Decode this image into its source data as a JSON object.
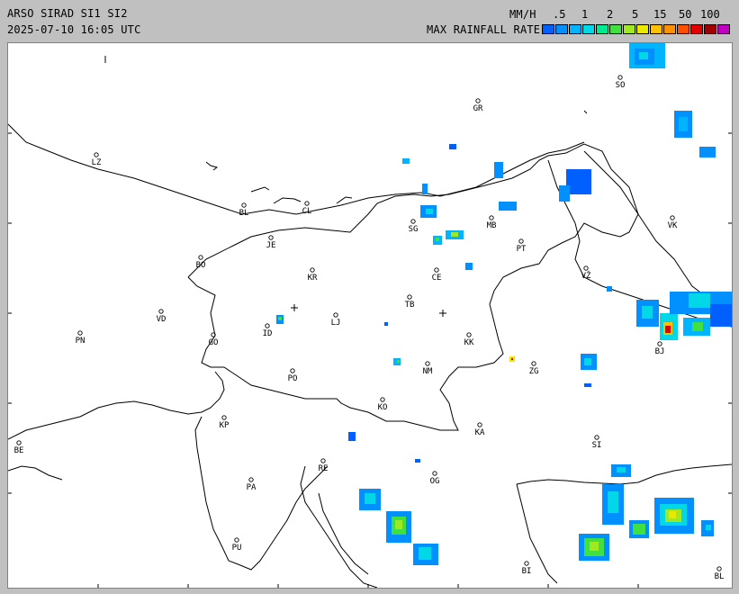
{
  "header": {
    "title": "ARSO SIRAD SI1 SI2",
    "timestamp": "2025-07-10 16:05 UTC",
    "unit": "MM/H",
    "legend_title": "MAX RAINFALL RATE"
  },
  "scale": {
    "labels": [
      ".5",
      "1",
      "2",
      "5",
      "15",
      "50",
      "100"
    ],
    "colors": [
      "#0060ff",
      "#0090ff",
      "#00b4ff",
      "#00d8e8",
      "#00e890",
      "#40e040",
      "#a0e820",
      "#e8e800",
      "#ffc000",
      "#ff9000",
      "#ff5000",
      "#e00000",
      "#a00000",
      "#c000c0"
    ]
  },
  "cities": [
    {
      "code": "GR"
    },
    {
      "code": "SO"
    },
    {
      "code": "LZ"
    },
    {
      "code": "BL"
    },
    {
      "code": "CL"
    },
    {
      "code": "MB"
    },
    {
      "code": "SG"
    },
    {
      "code": "VK"
    },
    {
      "code": "JE"
    },
    {
      "code": "PT"
    },
    {
      "code": "BO"
    },
    {
      "code": "KR"
    },
    {
      "code": "CE"
    },
    {
      "code": "VŽ"
    },
    {
      "code": "TB"
    },
    {
      "code": "VD"
    },
    {
      "code": "LJ"
    },
    {
      "code": "PN"
    },
    {
      "code": "ID"
    },
    {
      "code": "GO"
    },
    {
      "code": "KK"
    },
    {
      "code": "BJ"
    },
    {
      "code": "NM"
    },
    {
      "code": "ZG"
    },
    {
      "code": "PO"
    },
    {
      "code": "KO"
    },
    {
      "code": "KP"
    },
    {
      "code": "KA"
    },
    {
      "code": "SI"
    },
    {
      "code": "BE"
    },
    {
      "code": "RE"
    },
    {
      "code": "OG"
    },
    {
      "code": "PA"
    },
    {
      "code": "PU"
    },
    {
      "code": "BI"
    },
    {
      "code": "BL"
    }
  ]
}
